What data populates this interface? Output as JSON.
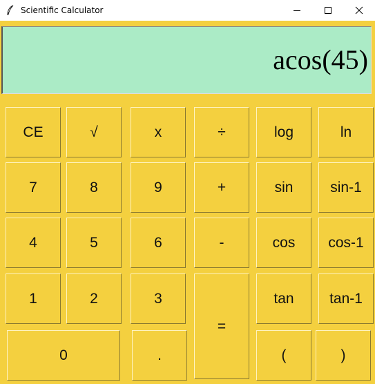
{
  "window": {
    "title": "Scientific Calculator",
    "icons": {
      "app": "feather-icon",
      "minimize": "minimize-icon",
      "maximize": "maximize-icon",
      "close": "close-icon"
    }
  },
  "display": {
    "expression": "acos(45)"
  },
  "keypad": {
    "ce": "CE",
    "sqrt": "√",
    "multiply": "x",
    "divide": "÷",
    "log": "log",
    "ln": "ln",
    "seven": "7",
    "eight": "8",
    "nine": "9",
    "plus": "+",
    "sin": "sin",
    "asin": "sin-1",
    "four": "4",
    "five": "5",
    "six": "6",
    "minus": "-",
    "cos": "cos",
    "acos": "cos-1",
    "one": "1",
    "two": "2",
    "three": "3",
    "equals": "=",
    "tan": "tan",
    "atan": "tan-1",
    "zero": "0",
    "dot": ".",
    "open_paren": "(",
    "close_paren": ")"
  },
  "colors": {
    "background": "#f4d03f",
    "display": "#abebc6",
    "button": "#f4d03f"
  }
}
